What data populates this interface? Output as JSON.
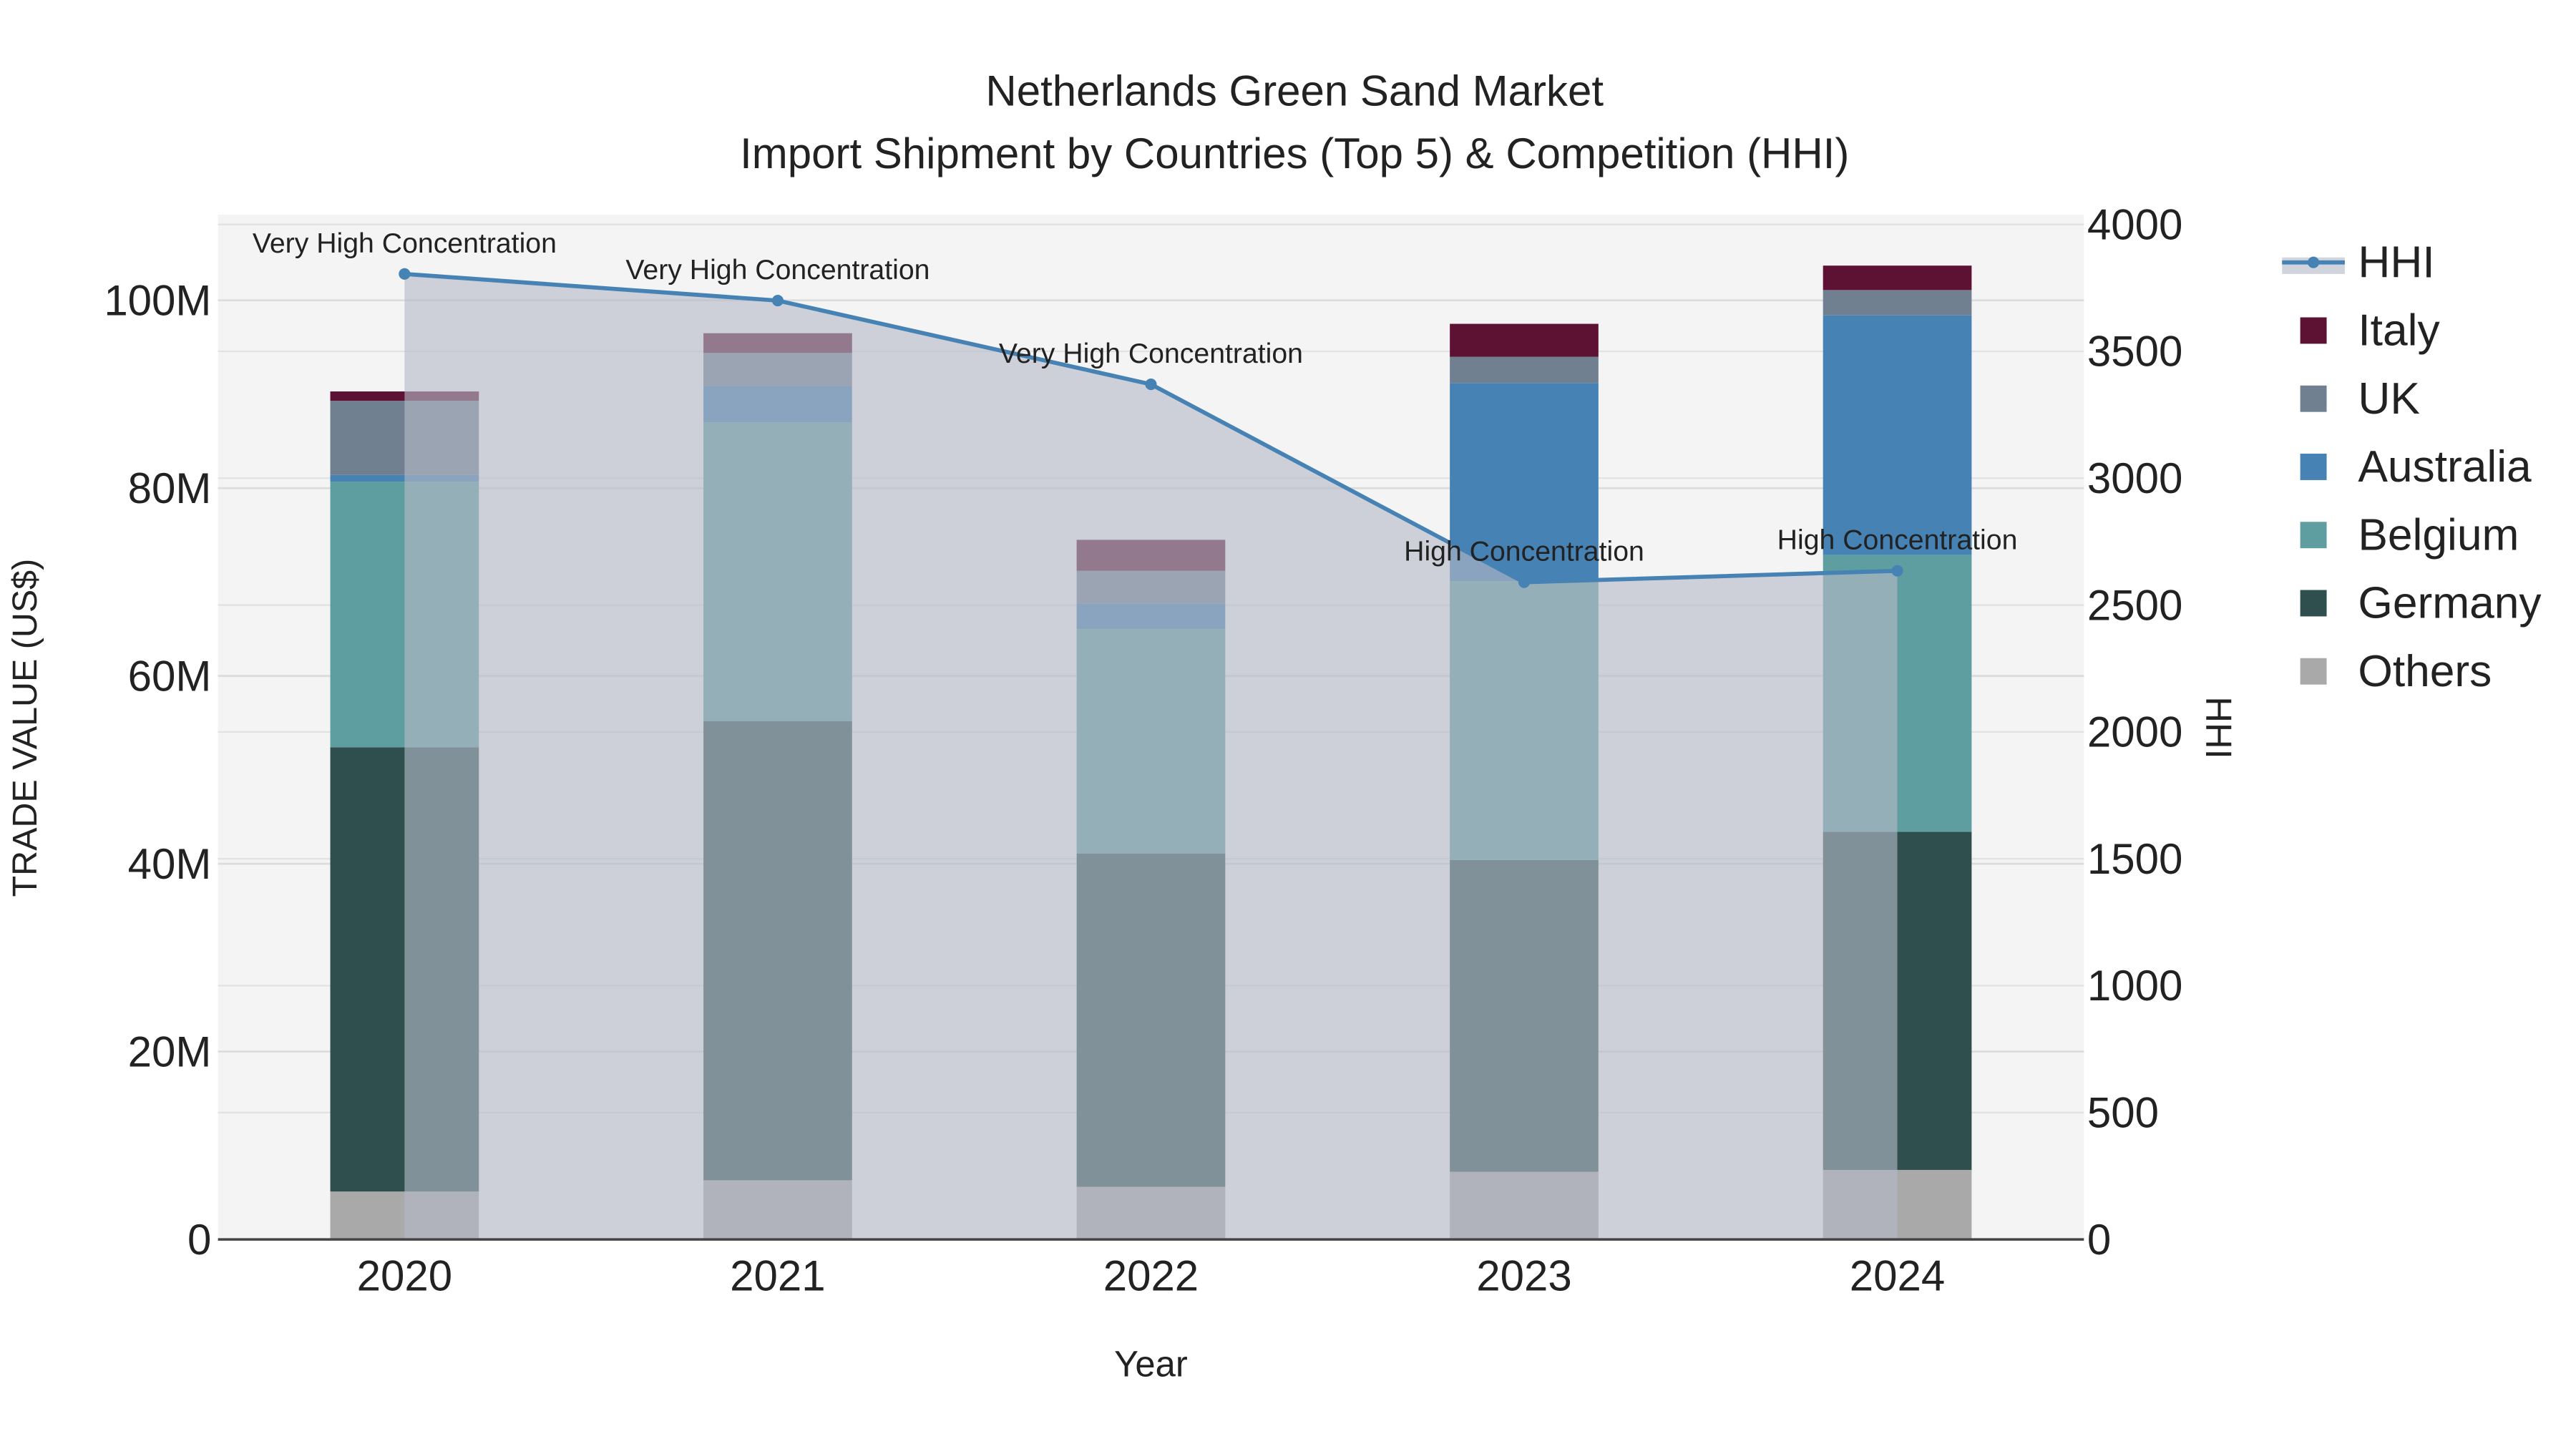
{
  "chart_data": {
    "type": "bar",
    "stacked": true,
    "title": "Netherlands Green Sand Market",
    "subtitle": "Import Shipment by Countries (Top 5) & Competition (HHI)",
    "xlabel": "Year",
    "ylabel": "TRADE VALUE (US$)",
    "y2label": "HHI",
    "categories": [
      "2020",
      "2021",
      "2022",
      "2023",
      "2024"
    ],
    "ylim": [
      0,
      108
    ],
    "y2lim": [
      0,
      4100
    ],
    "yticks": [
      {
        "v": 0,
        "label": "0"
      },
      {
        "v": 20,
        "label": "20M"
      },
      {
        "v": 40,
        "label": "40M"
      },
      {
        "v": 60,
        "label": "60M"
      },
      {
        "v": 80,
        "label": "80M"
      },
      {
        "v": 100,
        "label": "100M"
      }
    ],
    "y2ticks": [
      {
        "v": 0,
        "label": "0"
      },
      {
        "v": 500,
        "label": "500"
      },
      {
        "v": 1000,
        "label": "1000"
      },
      {
        "v": 1500,
        "label": "1500"
      },
      {
        "v": 2000,
        "label": "2000"
      },
      {
        "v": 2500,
        "label": "2500"
      },
      {
        "v": 3000,
        "label": "3000"
      },
      {
        "v": 3500,
        "label": "3500"
      },
      {
        "v": 4000,
        "label": "4000"
      }
    ],
    "units": "million US$",
    "series": [
      {
        "name": "Others",
        "color": "#a9a9a9",
        "values": [
          5.1,
          6.3,
          5.6,
          7.2,
          7.4
        ]
      },
      {
        "name": "Germany",
        "color": "#2f4f4f",
        "values": [
          47.3,
          48.9,
          35.5,
          33.2,
          36.0
        ]
      },
      {
        "name": "Belgium",
        "color": "#5f9ea0",
        "values": [
          28.3,
          31.8,
          23.9,
          29.7,
          29.5
        ]
      },
      {
        "name": "Australia",
        "color": "#4682b4",
        "values": [
          0.7,
          3.9,
          2.7,
          21.1,
          25.5
        ]
      },
      {
        "name": "UK",
        "color": "#708090",
        "values": [
          7.9,
          3.5,
          3.5,
          2.8,
          2.7
        ]
      },
      {
        "name": "Italy",
        "color": "#5e1233",
        "values": [
          1.0,
          2.1,
          3.3,
          3.5,
          2.6
        ]
      }
    ],
    "hhi": {
      "name": "HHI",
      "color": "#4682b4",
      "values": [
        3805,
        3700,
        3370,
        2590,
        2635
      ],
      "annotations": [
        "Very High Concentration",
        "Very High Concentration",
        "Very High Concentration",
        "High Concentration",
        "High Concentration"
      ]
    },
    "legend": {
      "placement": "right",
      "order": [
        "HHI",
        "Italy",
        "UK",
        "Australia",
        "Belgium",
        "Germany",
        "Others"
      ]
    },
    "grid": true
  }
}
